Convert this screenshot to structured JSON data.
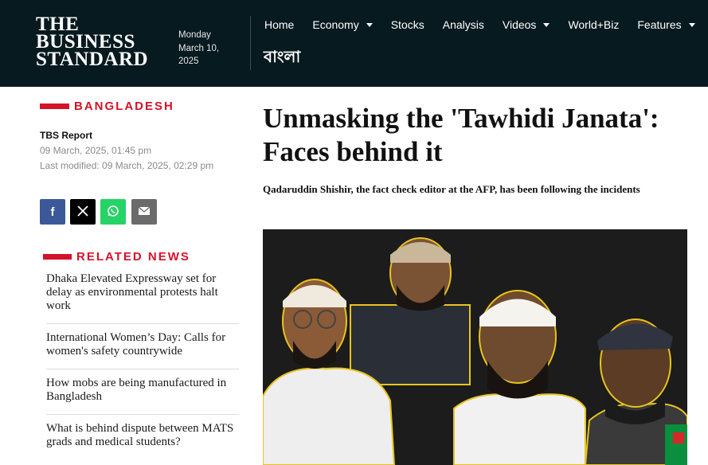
{
  "header": {
    "logo_line1": "THE",
    "logo_line2": "BUSINESS",
    "logo_line3": "STANDARD",
    "date_day": "Monday",
    "date_month_day": "March 10,",
    "date_year": "2025",
    "nav": [
      {
        "label": "Home",
        "has_dropdown": false
      },
      {
        "label": "Economy",
        "has_dropdown": true
      },
      {
        "label": "Stocks",
        "has_dropdown": false
      },
      {
        "label": "Analysis",
        "has_dropdown": false
      },
      {
        "label": "Videos",
        "has_dropdown": true
      },
      {
        "label": "World+Biz",
        "has_dropdown": false
      },
      {
        "label": "Features",
        "has_dropdown": true
      }
    ],
    "bangla_link": "বাংলা"
  },
  "article": {
    "section": "BANGLADESH",
    "author": "TBS Report",
    "published": "09 March, 2025, 01:45 pm",
    "last_modified": "Last modified: 09 March, 2025, 02:29 pm",
    "headline": "Unmasking the 'Tawhidi Janata': Faces behind it",
    "subhead": "Qadaruddin Shishir, the fact check editor at the AFP, has been following the incidents"
  },
  "share": {
    "facebook_icon": "f",
    "x_icon": "𝕏",
    "whatsapp_icon": "whatsapp-icon",
    "mail_icon": "mail-icon"
  },
  "related": {
    "label": "RELATED NEWS",
    "items": [
      "Dhaka Elevated Expressway set for delay as environmental protests halt work",
      "International Women’s Day: Calls for women's safety countrywide",
      "How mobs are being manufactured in Bangladesh",
      "What is behind dispute between MATS grads and medical students?"
    ]
  },
  "colors": {
    "header_bg": "#061a1f",
    "accent_red": "#d4122a",
    "facebook": "#3b5998",
    "whatsapp": "#25d366"
  }
}
